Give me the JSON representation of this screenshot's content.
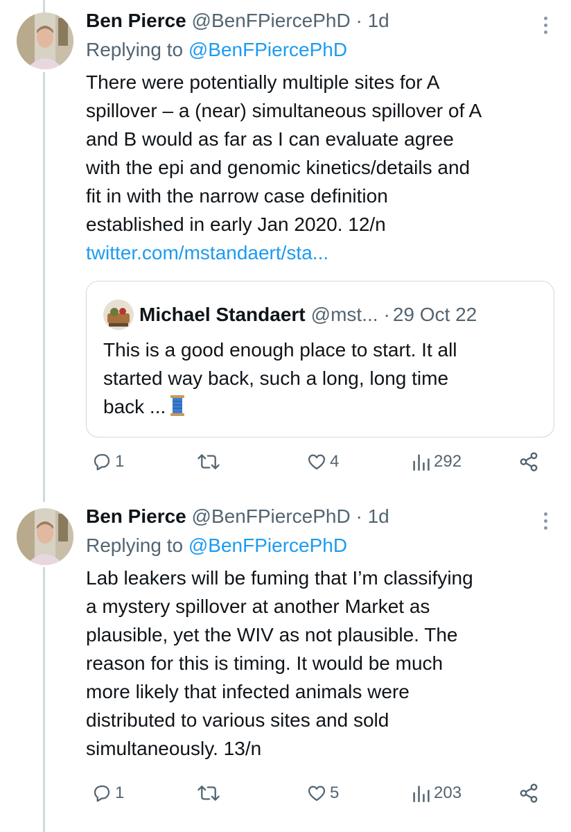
{
  "tweets": [
    {
      "author_name": "Ben Pierce",
      "author_handle": "@BenFPiercePhD",
      "separator": "·",
      "time": "1d",
      "replying_prefix": "Replying to",
      "replying_handle": "@BenFPiercePhD",
      "text_lines": [
        "There were potentially multiple sites for A",
        "spillover – a (near) simultaneous spillover of A",
        "and B would as far as I can evaluate agree",
        "with the epi and genomic kinetics/details and",
        "fit in with the narrow case definition",
        "established in early Jan 2020. 12/n"
      ],
      "link_text": "twitter.com/mstandaert/sta...",
      "quote": {
        "author_name": "Michael Standaert",
        "author_handle": "@mst...",
        "separator": "·",
        "time": "29 Oct 22",
        "text_lines": [
          "This is a good enough place to start. It all",
          "started way back, such a long, long time",
          "back ..."
        ],
        "emoji_icon": "spool-of-thread-icon"
      },
      "replies": "1",
      "retweets": "",
      "likes": "4",
      "views": "292"
    },
    {
      "author_name": "Ben Pierce",
      "author_handle": "@BenFPiercePhD",
      "separator": "·",
      "time": "1d",
      "replying_prefix": "Replying to",
      "replying_handle": "@BenFPiercePhD",
      "text_lines": [
        "Lab leakers will be fuming that I’m classifying",
        "a mystery spillover at another Market as",
        "plausible, yet the WIV as not plausible. The",
        "reason for this is timing. It would be much",
        "more likely that infected animals were",
        "distributed to various sites and sold",
        "simultaneously. 13/n"
      ],
      "replies": "1",
      "retweets": "",
      "likes": "5",
      "views": "203"
    }
  ],
  "colors": {
    "accent": "#1d9bf0",
    "muted": "#536471",
    "text": "#0f1419",
    "border": "#cfd9de"
  }
}
